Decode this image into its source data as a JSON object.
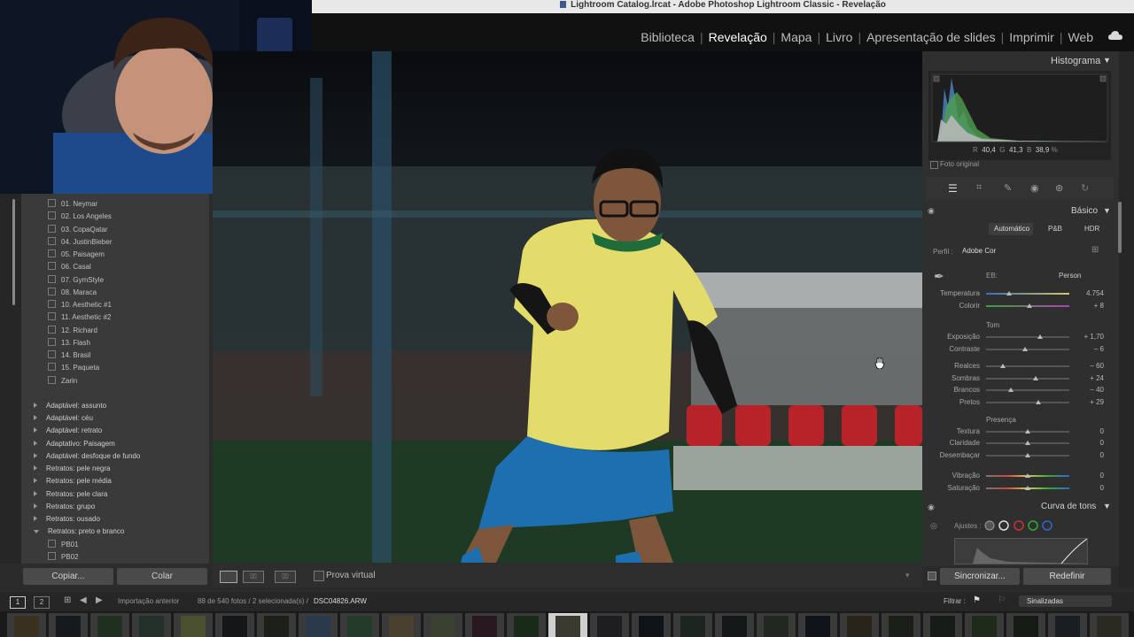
{
  "window": {
    "title": "Lightroom Catalog.lrcat - Adobe Photoshop Lightroom Classic - Revelação"
  },
  "modules": [
    {
      "label": "Biblioteca",
      "active": false
    },
    {
      "label": "Revelação",
      "active": true
    },
    {
      "label": "Mapa",
      "active": false
    },
    {
      "label": "Livro",
      "active": false
    },
    {
      "label": "Apresentação de slides",
      "active": false
    },
    {
      "label": "Imprimir",
      "active": false
    },
    {
      "label": "Web",
      "active": false
    }
  ],
  "presets": {
    "items": [
      "01. Neymar",
      "02. Los Angeles",
      "03. CopaQatar",
      "04. JustinBieber",
      "05. Paisagem",
      "06. Casal",
      "07. GymStyle",
      "08. Maraca",
      "10. Aesthetic #1",
      "11. Aesthetic #2",
      "12. Richard",
      "13. Flash",
      "14. Brasil",
      "15. Paqueta",
      "Zarin"
    ],
    "groups": [
      "Adaptável: assunto",
      "Adaptável: céu",
      "Adaptável: retrato",
      "Adaptativo: Paisagem",
      "Adaptável: desfoque de fundo",
      "Retratos: pele negra",
      "Retratos: pele média",
      "Retratos: pele clara",
      "Retratos: grupo",
      "Retratos: ousado",
      "Retratos: preto e branco"
    ],
    "subitems": [
      "PB01",
      "PB02"
    ]
  },
  "left_buttons": {
    "copy": "Copiar...",
    "paste": "Colar"
  },
  "toolbar": {
    "soft_proof": "Prova virtual"
  },
  "histogram": {
    "title": "Histograma",
    "r_label": "R",
    "r": "40,4",
    "g_label": "G",
    "g": "41,3",
    "b_label": "B",
    "b": "38,9",
    "pct": "%",
    "original_photo": "Foto original"
  },
  "basic": {
    "title": "Básico",
    "tabs": [
      "Automático",
      "P&B",
      "HDR"
    ],
    "profile_label": "Perfil :",
    "profile_value": "Adobe Cor",
    "wb_label": "EB:",
    "wb_value": "Person",
    "tone_title": "Tom",
    "presence_title": "Presença",
    "sliders": [
      {
        "label": "Temperatura",
        "value": "4.754",
        "pos": 0.28
      },
      {
        "label": "Colorir",
        "value": "+ 8",
        "pos": 0.52
      },
      {
        "label": "Exposição",
        "value": "+ 1,70",
        "pos": 0.65
      },
      {
        "label": "Contraste",
        "value": "– 6",
        "pos": 0.47
      },
      {
        "label": "Realces",
        "value": "– 60",
        "pos": 0.2
      },
      {
        "label": "Sombras",
        "value": "+ 24",
        "pos": 0.6
      },
      {
        "label": "Brancos",
        "value": "– 40",
        "pos": 0.3
      },
      {
        "label": "Pretos",
        "value": "+ 29",
        "pos": 0.63
      },
      {
        "label": "Textura",
        "value": "0",
        "pos": 0.5
      },
      {
        "label": "Claridade",
        "value": "0",
        "pos": 0.5
      },
      {
        "label": "Desembaçar",
        "value": "0",
        "pos": 0.5
      },
      {
        "label": "Vibração",
        "value": "0",
        "pos": 0.5
      },
      {
        "label": "Saturação",
        "value": "0",
        "pos": 0.5
      }
    ]
  },
  "tone_curve": {
    "title": "Curva de tons",
    "adjust_label": "Ajustes :"
  },
  "right_buttons": {
    "sync": "Sincronizar...",
    "reset": "Redefinir"
  },
  "filmbar": {
    "page1": "1",
    "page2": "2",
    "source": "Importação anterior",
    "count": "88 de 540 fotos / 2 selecionada(s) /",
    "filename": "DSC04826.ARW",
    "filter_label": "Filtrar :",
    "filter_value": "Sinalizadas"
  },
  "colors": {
    "accent": "#ffffff",
    "panel": "#2f2f2f",
    "background": "#2b2b2b"
  }
}
